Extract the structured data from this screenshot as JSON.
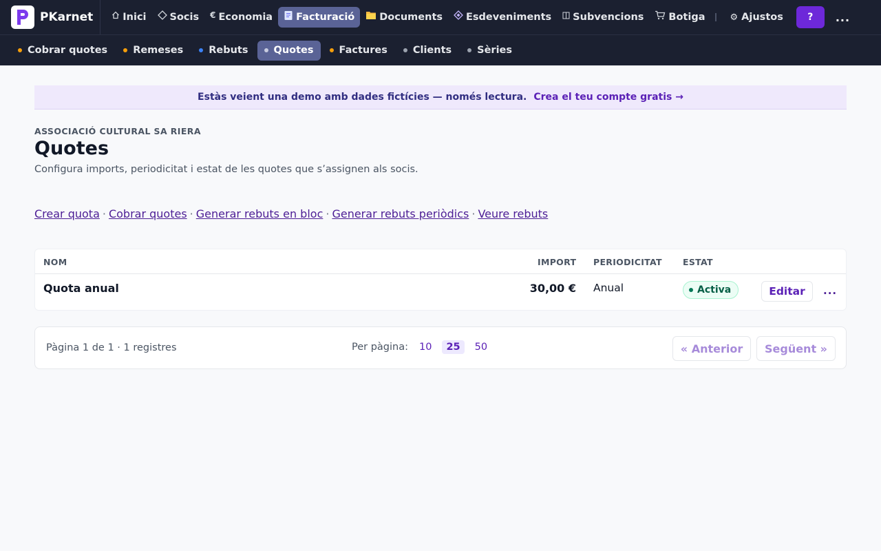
{
  "app": {
    "name": "PKarnet",
    "logo_letter": "P",
    "accent": "#6d28d9"
  },
  "topnav": {
    "items": [
      {
        "label": "Inici",
        "icon": "home-icon"
      },
      {
        "label": "Socis",
        "icon": "diamond-icon"
      },
      {
        "label": "Economia",
        "icon": "euro-icon"
      },
      {
        "label": "Facturació",
        "icon": "receipt-icon",
        "active": true
      },
      {
        "label": "Documents",
        "icon": "folder-icon"
      },
      {
        "label": "Esdeveniments",
        "icon": "diamond-filled-icon"
      },
      {
        "label": "Subvencions",
        "icon": "columns-icon"
      },
      {
        "label": "Botiga",
        "icon": "cart-icon"
      }
    ],
    "settings_label": "Ajustos",
    "help_label": "?",
    "more_label": "..."
  },
  "subnav": {
    "items": [
      {
        "label": "Cobrar quotes",
        "dot_color": "#f59e0b"
      },
      {
        "label": "Remeses",
        "dot_color": "#f59e0b"
      },
      {
        "label": "Rebuts",
        "dot_color": "#3b82f6"
      },
      {
        "label": "Quotes",
        "dot_color": "#c7cbe0",
        "active": true
      },
      {
        "label": "Factures",
        "dot_color": "#f59e0b"
      },
      {
        "label": "Clients",
        "dot_color": "#9ca3af"
      },
      {
        "label": "Sèries",
        "dot_color": "#9ca3af"
      }
    ]
  },
  "banner": {
    "message": "Estàs veient una demo amb dades fictícies — només lectura.",
    "cta": "Crea el teu compte gratis →"
  },
  "page": {
    "org": "ASSOCIACIÓ CULTURAL SA RIERA",
    "title": "Quotes",
    "subtitle": "Configura imports, periodicitat i estat de les quotes que s’assignen als socis."
  },
  "actions": {
    "links": [
      "Crear quota",
      "Cobrar quotes",
      "Generar rebuts en bloc",
      "Generar rebuts periòdics",
      "Veure rebuts"
    ],
    "separator": "·"
  },
  "table": {
    "columns": {
      "name": "NOM",
      "amount": "IMPORT",
      "period": "PERIODICITAT",
      "status": "ESTAT"
    },
    "rows": [
      {
        "name": "Quota anual",
        "amount": "30,00 €",
        "period": "Anual",
        "status": "Activa",
        "edit_label": "Editar",
        "more_label": "..."
      }
    ]
  },
  "pagination": {
    "info": "Pàgina 1 de 1 · 1 registres",
    "per_page_label": "Per pàgina:",
    "options": [
      "10",
      "25",
      "50"
    ],
    "selected": "25",
    "prev_label": "« Anterior",
    "next_label": "Següent »"
  }
}
